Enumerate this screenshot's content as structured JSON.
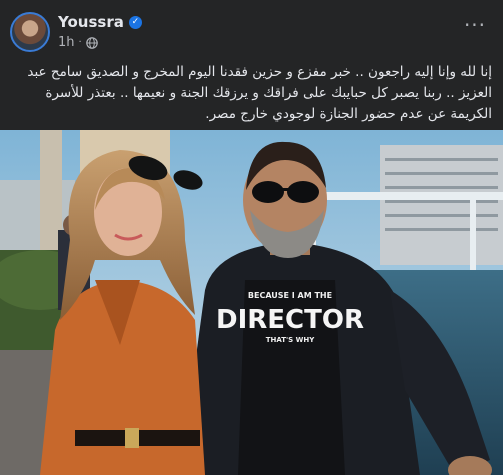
{
  "post": {
    "author": "Youssra",
    "time": "1h",
    "separator": "·",
    "more_label": "···",
    "text": "إنا لله وإنا إليه راجعون .. خبر مفزع و حزين فقدنا اليوم المخرج و الصديق سامح عبد العزيز .. ربنا يصبر كل حبايبك على فراقك و يرزقك الجنة و نعيمها .. بعتذر للأسرة الكريمة عن عدم حضور الجنازة لوجودي خارج مصر."
  },
  "photo": {
    "shirt_line1": "BECAUSE I AM THE",
    "shirt_line2": "DIRECTOR",
    "shirt_line3": "THAT'S WHY"
  },
  "icons": {
    "verified": "verified-badge-icon",
    "audience": "globe-icon",
    "more": "more-options-icon"
  },
  "colors": {
    "background": "#242526",
    "text": "#e4e6eb",
    "secondary_text": "#b0b3b8",
    "verified_blue": "#1b74e4"
  }
}
